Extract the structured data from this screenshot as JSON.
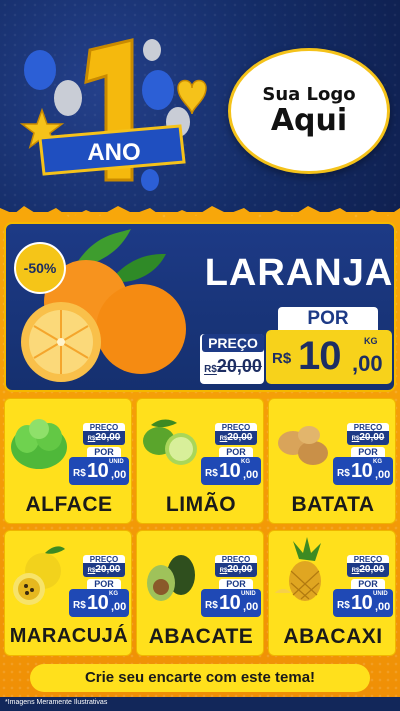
{
  "header": {
    "anniversary_number": "1",
    "anniversary_word": "ANO",
    "logo_line1": "Sua Logo",
    "logo_line2": "Aqui"
  },
  "featured": {
    "name": "LARANJA",
    "discount": "-50%",
    "preco_label": "PREÇO",
    "old_currency": "R$",
    "old_int": "20",
    "old_dec": ",00",
    "por_label": "POR",
    "currency": "R$",
    "price_int": "10",
    "price_dec": ",00",
    "unit": "KG"
  },
  "products": [
    {
      "name": "ALFACE",
      "preco_label": "PREÇO",
      "old_currency": "R$",
      "old_int": "20",
      "old_dec": ",00",
      "por_label": "POR",
      "currency": "R$",
      "price_int": "10",
      "price_dec": ",00",
      "unit": "UNID",
      "icon": "lettuce-icon"
    },
    {
      "name": "LIMÃO",
      "preco_label": "PREÇO",
      "old_currency": "R$",
      "old_int": "20",
      "old_dec": ",00",
      "por_label": "POR",
      "currency": "R$",
      "price_int": "10",
      "price_dec": ",00",
      "unit": "KG",
      "icon": "lime-icon"
    },
    {
      "name": "BATATA",
      "preco_label": "PREÇO",
      "old_currency": "R$",
      "old_int": "20",
      "old_dec": ",00",
      "por_label": "POR",
      "currency": "R$",
      "price_int": "10",
      "price_dec": ",00",
      "unit": "KG",
      "icon": "potato-icon"
    },
    {
      "name": "MARACUJÁ",
      "preco_label": "PREÇO",
      "old_currency": "R$",
      "old_int": "20",
      "old_dec": ",00",
      "por_label": "POR",
      "currency": "R$",
      "price_int": "10",
      "price_dec": ",00",
      "unit": "KG",
      "icon": "passion-fruit-icon"
    },
    {
      "name": "ABACATE",
      "preco_label": "PREÇO",
      "old_currency": "R$",
      "old_int": "20",
      "old_dec": ",00",
      "por_label": "POR",
      "currency": "R$",
      "price_int": "10",
      "price_dec": ",00",
      "unit": "UNID",
      "icon": "avocado-icon"
    },
    {
      "name": "ABACAXI",
      "preco_label": "PREÇO",
      "old_currency": "R$",
      "old_int": "20",
      "old_dec": ",00",
      "por_label": "POR",
      "currency": "R$",
      "price_int": "10",
      "price_dec": ",00",
      "unit": "UNID",
      "icon": "pineapple-icon"
    }
  ],
  "footer": {
    "cta": "Crie seu encarte com este tema!",
    "disclaimer": "*Imagens Meramente Ilustrativas"
  },
  "colors": {
    "navy": "#1d3a86",
    "yellow": "#ffe01c",
    "orange": "#f8a70a",
    "price_blue": "#1f49b5"
  }
}
